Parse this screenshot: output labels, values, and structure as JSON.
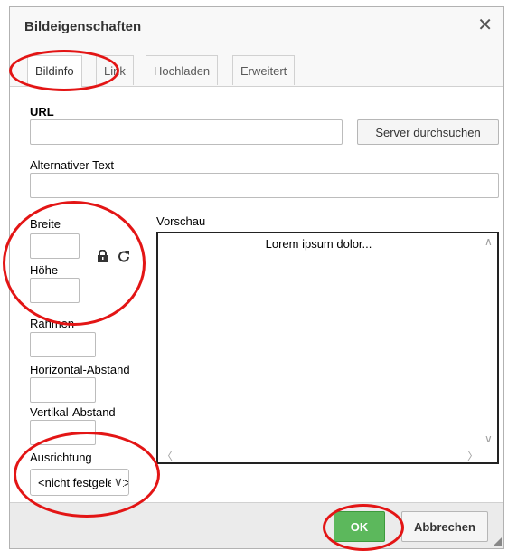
{
  "dialog": {
    "title": "Bildeigenschaften",
    "close_icon": "close-icon"
  },
  "tabs": [
    {
      "label": "Bildinfo",
      "active": true
    },
    {
      "label": "Link",
      "active": false
    },
    {
      "label": "Hochladen",
      "active": false
    },
    {
      "label": "Erweitert",
      "active": false
    }
  ],
  "form": {
    "url_label": "URL",
    "url_value": "",
    "browse_button": "Server durchsuchen",
    "alt_label": "Alternativer Text",
    "alt_value": "",
    "width_label": "Breite",
    "width_value": "",
    "height_label": "Höhe",
    "height_value": "",
    "lock_icon": "lock-icon",
    "reset_icon": "refresh-icon",
    "border_label": "Rahmen",
    "hspace_label": "Horizontal-Abstand",
    "vspace_label": "Vertikal-Abstand",
    "align_label": "Ausrichtung",
    "align_value": "<nicht festgelegt>"
  },
  "preview": {
    "label": "Vorschau",
    "text": "Lorem ipsum dolor..."
  },
  "footer": {
    "ok_label": "OK",
    "cancel_label": "Abbrechen"
  },
  "colors": {
    "ok_button": "#5cb85c",
    "annotation": "#e31515"
  }
}
